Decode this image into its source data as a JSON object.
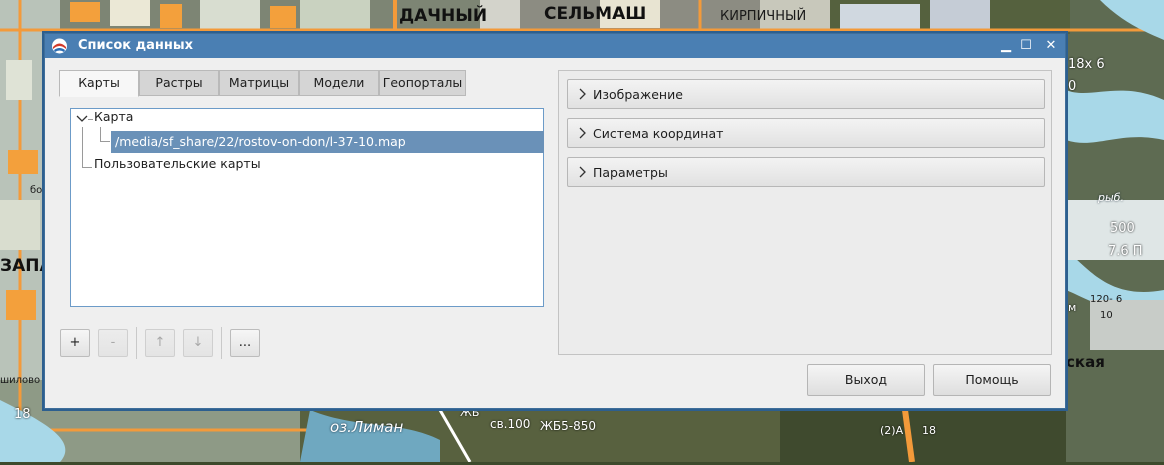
{
  "map": {
    "labels": {
      "dachny": "ДАЧНЫЙ",
      "selmash": "СЕЛЬМАШ",
      "kirpichny": "КИРПИЧНЫЙ",
      "zapad": "ЗАПАД",
      "ozliman": "оз.Лиман",
      "sv100": "св.100",
      "zhb": "ЖБ5-850",
      "zhb_short": "ЖБ",
      "skaya": "ская",
      "right_18x6": "18х 6",
      "right_0": "0",
      "right_500": "500",
      "right_76p": "7.6 П",
      "right_ryb": "рыб.",
      "right_120": "120- 6",
      "right_10": "10",
      "right_m": "м",
      "left_18": "18",
      "left_shilovo": "шилово",
      "bottom_2a": "(2)А",
      "bottom_18": "18",
      "left_bo": "бо"
    }
  },
  "dialog": {
    "title": "Список данных",
    "window_buttons": {
      "minimize": "▁",
      "maximize": "☐",
      "close": "✕"
    },
    "tabs": [
      {
        "label": "Карты",
        "active": true
      },
      {
        "label": "Растры",
        "active": false
      },
      {
        "label": "Матрицы",
        "active": false
      },
      {
        "label": "Модели",
        "active": false
      },
      {
        "label": "Геопорталы",
        "active": false
      }
    ],
    "tree": {
      "root": "Карта",
      "selected_item": "/media/sf_share/22/rostov-on-don/l-37-10.map",
      "user_maps": "Пользовательские карты"
    },
    "toolbar": {
      "add": "+",
      "remove": "-",
      "up": "↑",
      "down": "↓",
      "more": "..."
    },
    "sections": [
      {
        "label": "Изображение"
      },
      {
        "label": "Система координат"
      },
      {
        "label": "Параметры"
      }
    ],
    "buttons": {
      "exit": "Выход",
      "help": "Помощь"
    }
  },
  "colors": {
    "titlebar": "#4a7fb3",
    "selection": "#6a91b8",
    "tree_border": "#6c9bc8",
    "map_road": "#f39a3a",
    "map_water": "#a8d8e8"
  }
}
